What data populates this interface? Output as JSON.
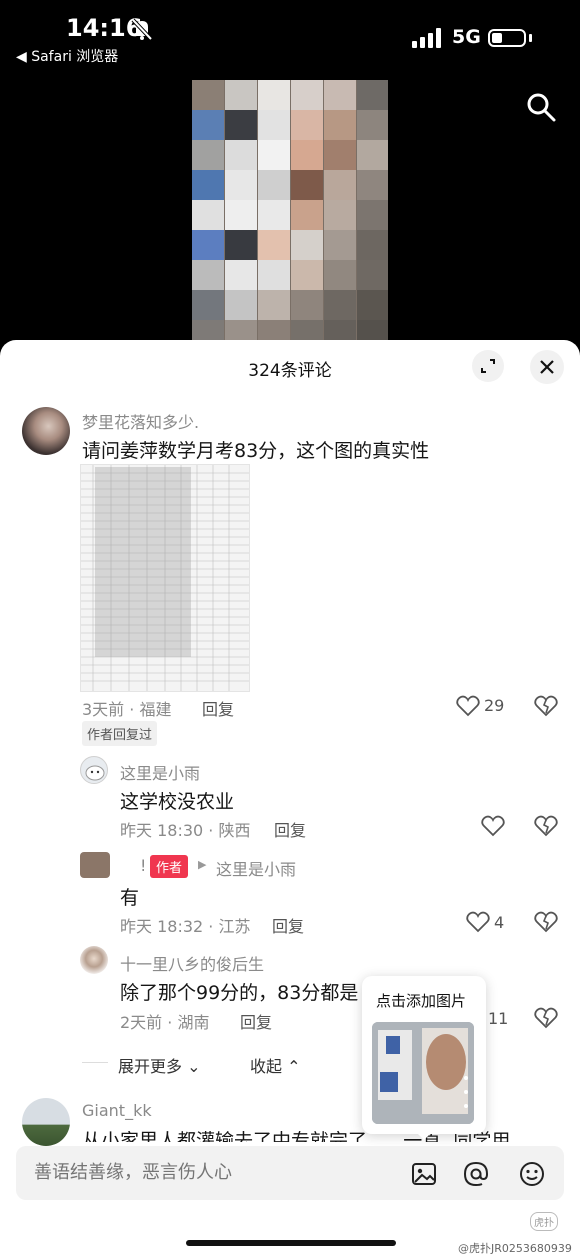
{
  "status_bar": {
    "time": "14:16",
    "back_app": "◀ Safari 浏览器",
    "network": "5G"
  },
  "sheet": {
    "comment_count": "324条评论"
  },
  "comments": [
    {
      "username": "梦里花落知多少.",
      "text": "请问姜萍数学月考83分，这个图的真实性",
      "meta": "3天前 · 福建",
      "reply_label": "回复",
      "likes": "29",
      "author_replied_badge": "作者回复过"
    }
  ],
  "replies": [
    {
      "username": "这里是小雨",
      "text": "这学校没农业",
      "meta": "昨天 18:30 · 陕西",
      "reply_label": "回复",
      "likes": ""
    },
    {
      "username": "!",
      "author_tag": "作者",
      "reply_to": "这里是小雨",
      "text": "有",
      "meta": "昨天 18:32 · 江苏",
      "reply_label": "回复",
      "likes": "4"
    },
    {
      "username": "十一里八乡的俊后生",
      "text": "除了那个99分的，83分都是",
      "meta": "2天前 · 湖南",
      "reply_label": "回复",
      "likes": "11"
    }
  ],
  "thread_controls": {
    "expand_more": "展开更多",
    "collapse": "收起"
  },
  "next_comment": {
    "username": "Giant_kk",
    "text": "从小家里人都灌输去了中专就完了......一直..同学用"
  },
  "popup": {
    "label": "点击添加图片"
  },
  "input_bar": {
    "placeholder": "善语结善缘，恶言伤人心"
  },
  "watermark": {
    "text": "@虎扑JR0253680939",
    "logo": "虎扑"
  },
  "colors": {
    "accent_author_tag": "#f0364f",
    "sheet_background": "#ffffff",
    "page_background": "#000000"
  },
  "icons": [
    "bell-muted-icon",
    "signal-icon",
    "battery-icon",
    "search-icon",
    "expand-icon",
    "close-icon",
    "heart-icon",
    "dislike-icon",
    "image-icon",
    "at-icon",
    "emoji-icon",
    "chevron-down-icon",
    "chevron-up-icon"
  ]
}
